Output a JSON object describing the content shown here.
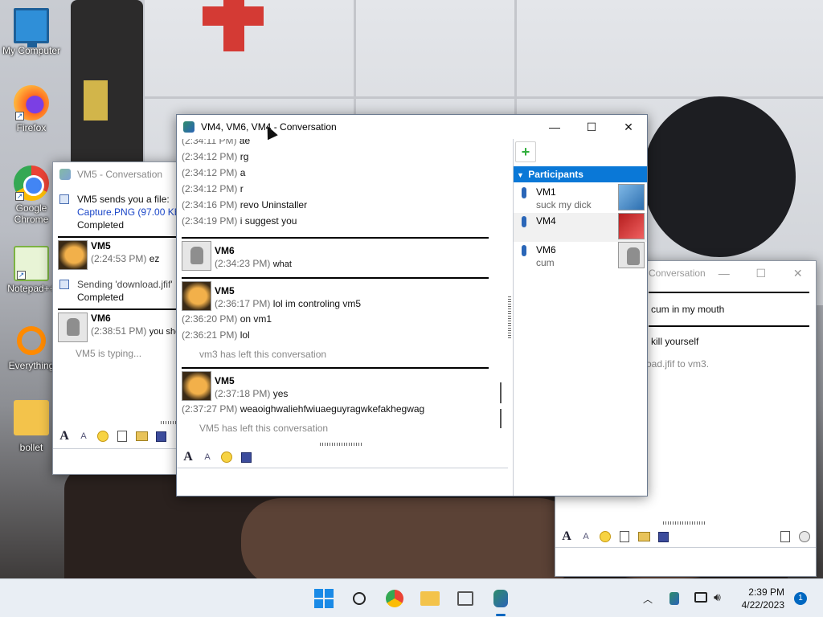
{
  "desktop": {
    "icons": [
      {
        "label": "My Computer",
        "icon": "monitor-icon"
      },
      {
        "label": "Firefox",
        "icon": "firefox-icon"
      },
      {
        "label": "Google Chrome",
        "icon": "chrome-icon"
      },
      {
        "label": "Notepad++",
        "icon": "notepad-plus-plus-icon"
      },
      {
        "label": "Everything",
        "icon": "everything-search-icon"
      },
      {
        "label": "bollet",
        "icon": "folder-icon"
      }
    ]
  },
  "win_left": {
    "title": "VM5 - Conversation",
    "file_msg": "VM5 sends you a file:",
    "file_name": "Capture.PNG (97.00 KB)",
    "file_status": "Completed",
    "block1_name": "VM5",
    "block1_ts": "(2:24:53 PM)",
    "block1_text": "ez",
    "sending_msg": "Sending 'download.jfif'",
    "sending_status": "Completed",
    "block2_name": "VM6",
    "block2_ts": "(2:38:51 PM)",
    "block2_text": "you should",
    "typing": "VM5 is typing..."
  },
  "win_right": {
    "title": "Conversation",
    "line1": "cum in my mouth",
    "line2": "kill yourself",
    "line3": "oad.jfif to vm3."
  },
  "win_main": {
    "title": "VM4, VM6, VM4 - Conversation",
    "top_lines": [
      {
        "ts": "(2:34:11 PM)",
        "text": "ae"
      },
      {
        "ts": "(2:34:12 PM)",
        "text": "rg"
      },
      {
        "ts": "(2:34:12 PM)",
        "text": "a"
      },
      {
        "ts": "(2:34:12 PM)",
        "text": "r"
      },
      {
        "ts": "(2:34:16 PM)",
        "text": "revo Uninstaller"
      },
      {
        "ts": "(2:34:19 PM)",
        "text": "i suggest you"
      }
    ],
    "vm6_block": {
      "name": "VM6",
      "ts": "(2:34:23 PM)",
      "text": "what"
    },
    "vm5_block": {
      "name": "VM5",
      "first_ts": "(2:36:17 PM)",
      "first_text": "lol im controling vm5",
      "lines": [
        {
          "ts": "(2:36:20 PM)",
          "text": "on vm1"
        },
        {
          "ts": "(2:36:21 PM)",
          "text": "lol"
        }
      ]
    },
    "left_msg": "vm3 has left this conversation",
    "vm5_block2": {
      "name": "VM5",
      "first_ts": "(2:37:18 PM)",
      "first_text": "yes",
      "line_ts": "(2:37:27 PM)",
      "line_text": "weaoighwaliehfwiuaeguyragwkefakhegwag"
    },
    "left_msg2": "VM5 has left this conversation",
    "participants_header": "Participants",
    "participants": [
      {
        "name": "VM1",
        "status": "suck my dick"
      },
      {
        "name": "VM4",
        "status": ""
      },
      {
        "name": "VM6",
        "status": "cum"
      }
    ]
  },
  "taskbar": {
    "time": "2:39 PM",
    "date": "4/22/2023",
    "notification_count": "1",
    "apps": [
      "start-icon",
      "search-icon",
      "chrome-icon",
      "file-explorer-icon",
      "app-icon",
      "messenger-icon"
    ]
  },
  "colors": {
    "participants_header_bg": "#0a78d7",
    "link": "#1a46c8",
    "accent": "#0067c0"
  }
}
